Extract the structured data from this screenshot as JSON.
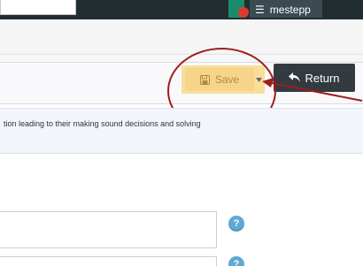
{
  "topbar": {
    "user_label": "mestepp",
    "menu_icon": "hamburger-icon"
  },
  "toolbar": {
    "save_label": "Save",
    "save_icon": "floppy-disk-icon",
    "return_label": "Return",
    "return_icon": "reply-arrow-icon"
  },
  "info": {
    "text": "tion leading to their making sound decisions and solving"
  },
  "form": {
    "help_glyph": "?"
  },
  "colors": {
    "save_button_bg": "#f6d58a",
    "return_button_bg": "#333b40",
    "annotation_red": "#9e1d1d",
    "help_icon_blue": "#5ea9d6"
  }
}
